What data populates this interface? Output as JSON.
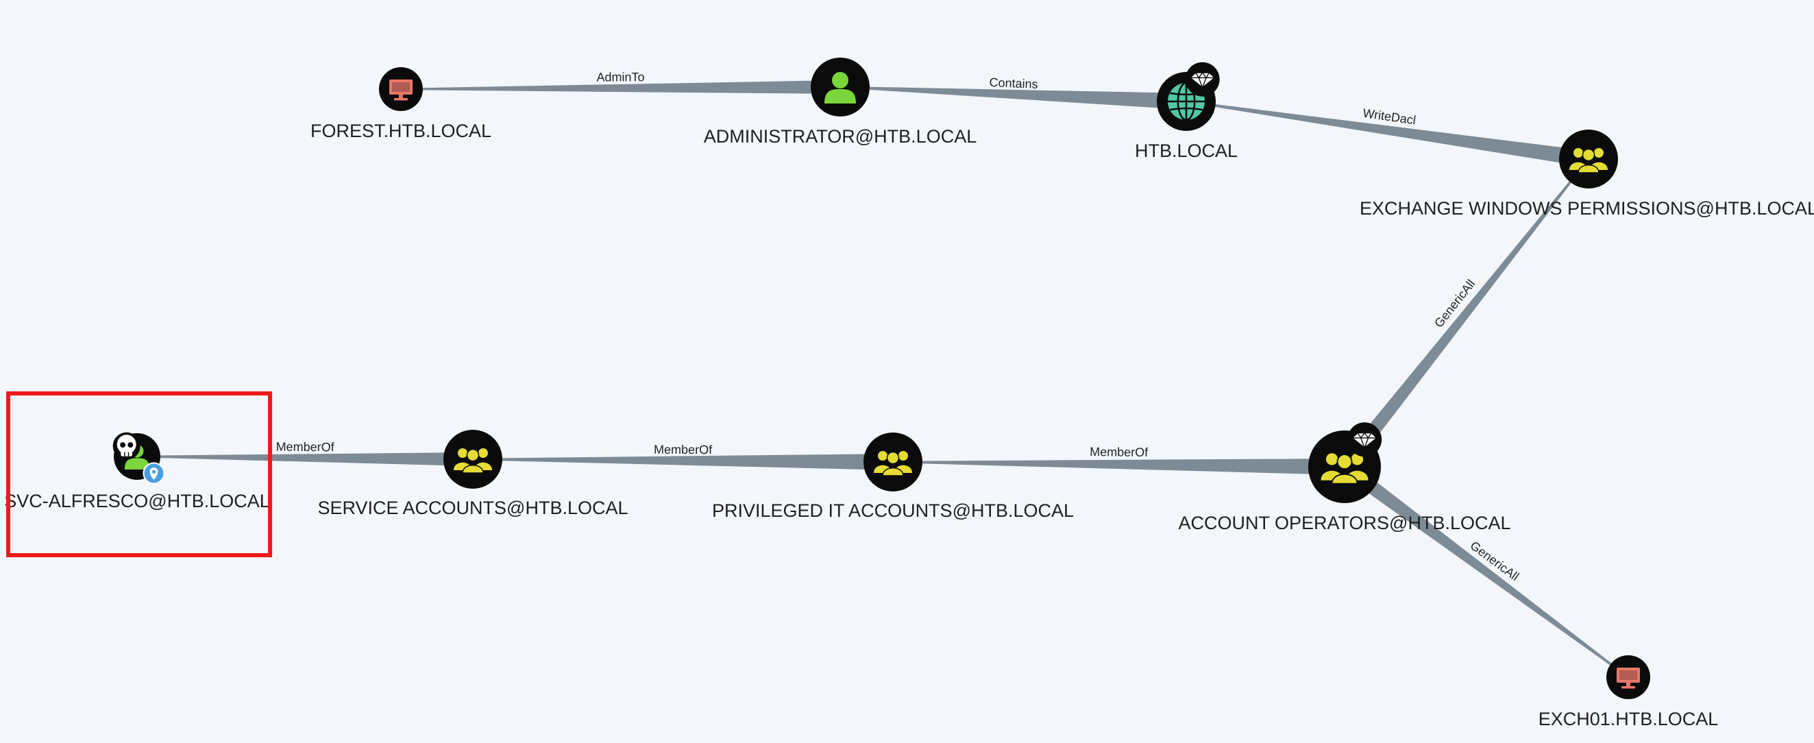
{
  "colors": {
    "background": "#f3f6fa",
    "edge": "#7d8b96",
    "node_circle": "#0b0b0b",
    "user": "#7ad63a",
    "group": "#e4dc34",
    "domain": "#4fc9a6",
    "computer": "#e8786a",
    "selection": "#ee1b1b",
    "owned_skull": "#ffffff",
    "high_value_diamond": "#ffffff",
    "location_badge": "#4a9fe0"
  },
  "nodes": [
    {
      "id": "forest",
      "label": "FOREST.HTB.LOCAL",
      "kind": "computer",
      "icon": "computer-icon"
    },
    {
      "id": "administrator",
      "label": "ADMINISTRATOR@HTB.LOCAL",
      "kind": "user",
      "icon": "user-icon"
    },
    {
      "id": "htb",
      "label": "HTB.LOCAL",
      "kind": "domain",
      "icon": "globe-icon",
      "badge": "diamond-icon"
    },
    {
      "id": "ewp",
      "label": "EXCHANGE WINDOWS PERMISSIONS@HTB.LOCAL",
      "kind": "group",
      "icon": "group-icon"
    },
    {
      "id": "svc",
      "label": "SVC-ALFRESCO@HTB.LOCAL",
      "kind": "user",
      "icon": "user-icon",
      "badge": "skull-icon",
      "badge2": "location-pin-icon",
      "selected": true
    },
    {
      "id": "service",
      "label": "SERVICE ACCOUNTS@HTB.LOCAL",
      "kind": "group",
      "icon": "group-icon"
    },
    {
      "id": "privit",
      "label": "PRIVILEGED IT ACCOUNTS@HTB.LOCAL",
      "kind": "group",
      "icon": "group-icon"
    },
    {
      "id": "accops",
      "label": "ACCOUNT OPERATORS@HTB.LOCAL",
      "kind": "group",
      "icon": "group-icon",
      "badge": "diamond-icon"
    },
    {
      "id": "exch01",
      "label": "EXCH01.HTB.LOCAL",
      "kind": "computer",
      "icon": "computer-icon"
    }
  ],
  "edges": [
    {
      "from": "forest",
      "to": "administrator",
      "label": "AdminTo"
    },
    {
      "from": "administrator",
      "to": "htb",
      "label": "Contains"
    },
    {
      "from": "htb",
      "to": "ewp",
      "label": "WriteDacl"
    },
    {
      "from": "ewp",
      "to": "accops",
      "label": "GenericAll"
    },
    {
      "from": "svc",
      "to": "service",
      "label": "MemberOf"
    },
    {
      "from": "service",
      "to": "privit",
      "label": "MemberOf"
    },
    {
      "from": "privit",
      "to": "accops",
      "label": "MemberOf"
    },
    {
      "from": "exch01",
      "to": "accops",
      "label": "GenericAll"
    }
  ]
}
